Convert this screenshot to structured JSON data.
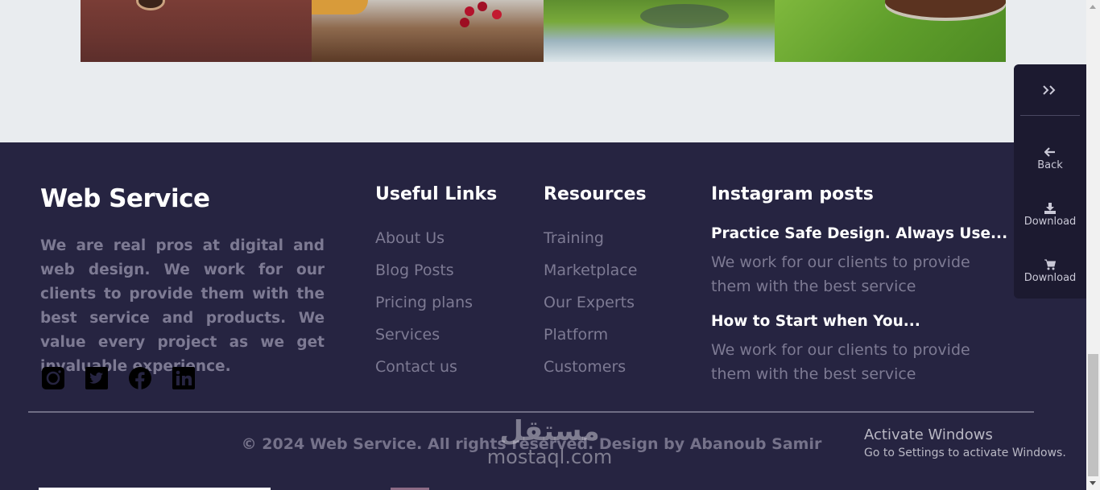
{
  "footer": {
    "brand": {
      "title": "Web Service",
      "text": "We are real pros at digital and web design. We work for our clients to provide them with the best service and products. We value every project as we get invaluable experience."
    },
    "social_icons": [
      "instagram-icon",
      "twitter-icon",
      "facebook-icon",
      "linkedin-icon"
    ],
    "useful_links": {
      "title": "Useful Links",
      "items": [
        "About Us",
        "Blog Posts",
        "Pricing plans",
        "Services",
        "Contact us"
      ]
    },
    "resources": {
      "title": "Resources",
      "items": [
        "Training",
        "Marketplace",
        "Our Experts",
        "Platform",
        "Customers"
      ]
    },
    "instagram": {
      "title": "Instagram posts",
      "posts": [
        {
          "title": "Practice Safe Design. Always Use...",
          "text": "We work for our clients to provide them with the best service"
        },
        {
          "title": "How to Start when You...",
          "text": "We work for our clients to provide them with the best service"
        }
      ]
    },
    "copyright": "© 2024 Web Service. All rights reserved. Design by Abanoub Samir"
  },
  "watermark": {
    "arabic": "مستقل",
    "latin": "mostaql.com"
  },
  "activate_windows": {
    "title": "Activate Windows",
    "subtitle": "Go to Settings to activate Windows."
  },
  "side_panel": {
    "toggle_label": "»",
    "items": [
      {
        "label": "Back",
        "icon": "arrow-left-icon"
      },
      {
        "label": "Download",
        "icon": "download-icon"
      },
      {
        "label": "Download",
        "icon": "cart-icon"
      }
    ]
  },
  "colors": {
    "footer_bg": "#262441",
    "page_bg": "#e9ecef",
    "muted_text": "#7d7a93",
    "heading_text": "#ffffff",
    "side_panel_bg": "#1c1a30"
  }
}
